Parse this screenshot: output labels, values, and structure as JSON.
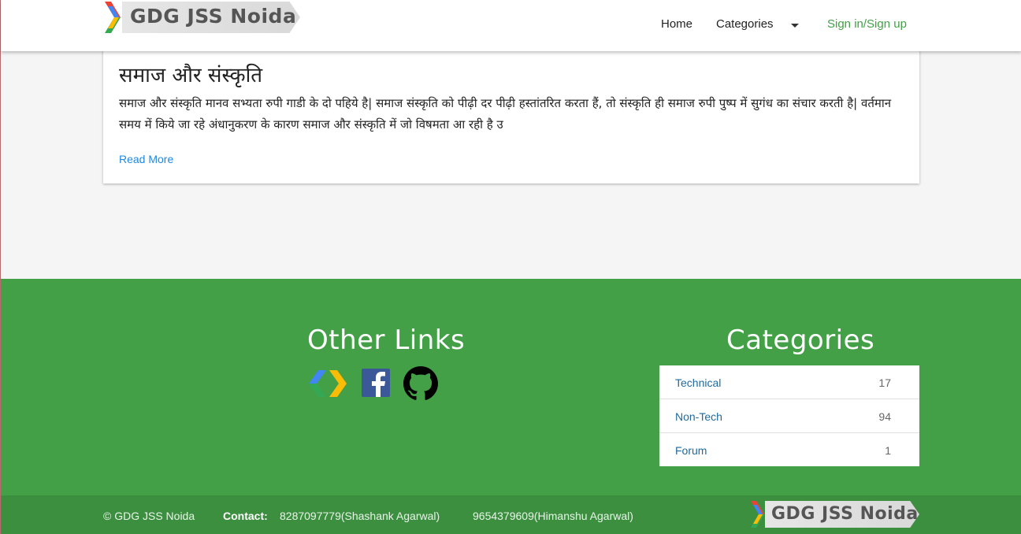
{
  "navbar": {
    "logo_text": "GDG  JSS Noida",
    "links": {
      "home": "Home",
      "categories": "Categories",
      "signin": "Sign in/Sign up"
    }
  },
  "post": {
    "title": "समाज और संस्कृति",
    "excerpt": "समाज और संस्कृति मानव सभ्यता रुपी गाडी के दो पहिये है| समाज संस्कृति को पीढ़ी दर पीढ़ी हस्तांतरित करता हैं, तो संस्कृति ही समाज रुपी पुष्प में सुगंध का संचार करती है| वर्तमान समय में किये जा रहे अंधानुकरण के कारण समाज और संस्कृति में जो विषमता आ रही है उ",
    "read_more": "Read More"
  },
  "footer": {
    "other_links_heading": "Other Links",
    "categories_heading": "Categories",
    "icons": [
      "gdg-icon",
      "facebook-icon",
      "github-icon"
    ],
    "categories": [
      {
        "name": "Technical",
        "count": "17"
      },
      {
        "name": "Non-Tech",
        "count": "94"
      },
      {
        "name": "Forum",
        "count": "1"
      }
    ]
  },
  "bottom_bar": {
    "copyright": "© GDG JSS Noida",
    "contact_label": "Contact:",
    "contact_1": "8287097779(Shashank Agarwal)",
    "contact_2": "9654379609(Himanshu Agarwal)",
    "logo_text": "GDG  JSS Noida"
  },
  "colors": {
    "footer_green": "#43a047",
    "bottom_bar_green": "#3d8f40",
    "link_blue": "#1e88e5",
    "signin_green": "#43a047"
  }
}
